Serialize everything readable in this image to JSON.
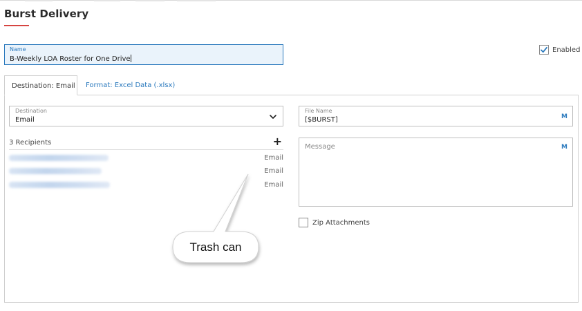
{
  "header": {
    "title": "Burst Delivery"
  },
  "name_field": {
    "label": "Name",
    "value": "B-Weekly LOA Roster for One Drive"
  },
  "enabled": {
    "label": "Enabled",
    "checked": true
  },
  "tabs": [
    {
      "label": "Destination: Email",
      "active": true
    },
    {
      "label": "Format: Excel Data (.xlsx)",
      "active": false
    }
  ],
  "destination": {
    "label": "Destination",
    "value": "Email"
  },
  "recipients": {
    "header": "3 Recipients",
    "add_icon": "plus-icon",
    "items": [
      {
        "type": "Email"
      },
      {
        "type": "Email"
      },
      {
        "type": "Email"
      }
    ]
  },
  "file_name": {
    "label": "File Name",
    "value": "[$BURST]",
    "macro_label": "M"
  },
  "message": {
    "placeholder": "Message",
    "macro_label": "M"
  },
  "zip": {
    "label": "Zip Attachments",
    "checked": false
  },
  "callout": {
    "text": "Trash can"
  },
  "colors": {
    "accent_blue": "#2a79bd",
    "title_underline": "#d64541",
    "input_focus_bg": "#eaf3fb",
    "border": "#cfcfcf"
  }
}
